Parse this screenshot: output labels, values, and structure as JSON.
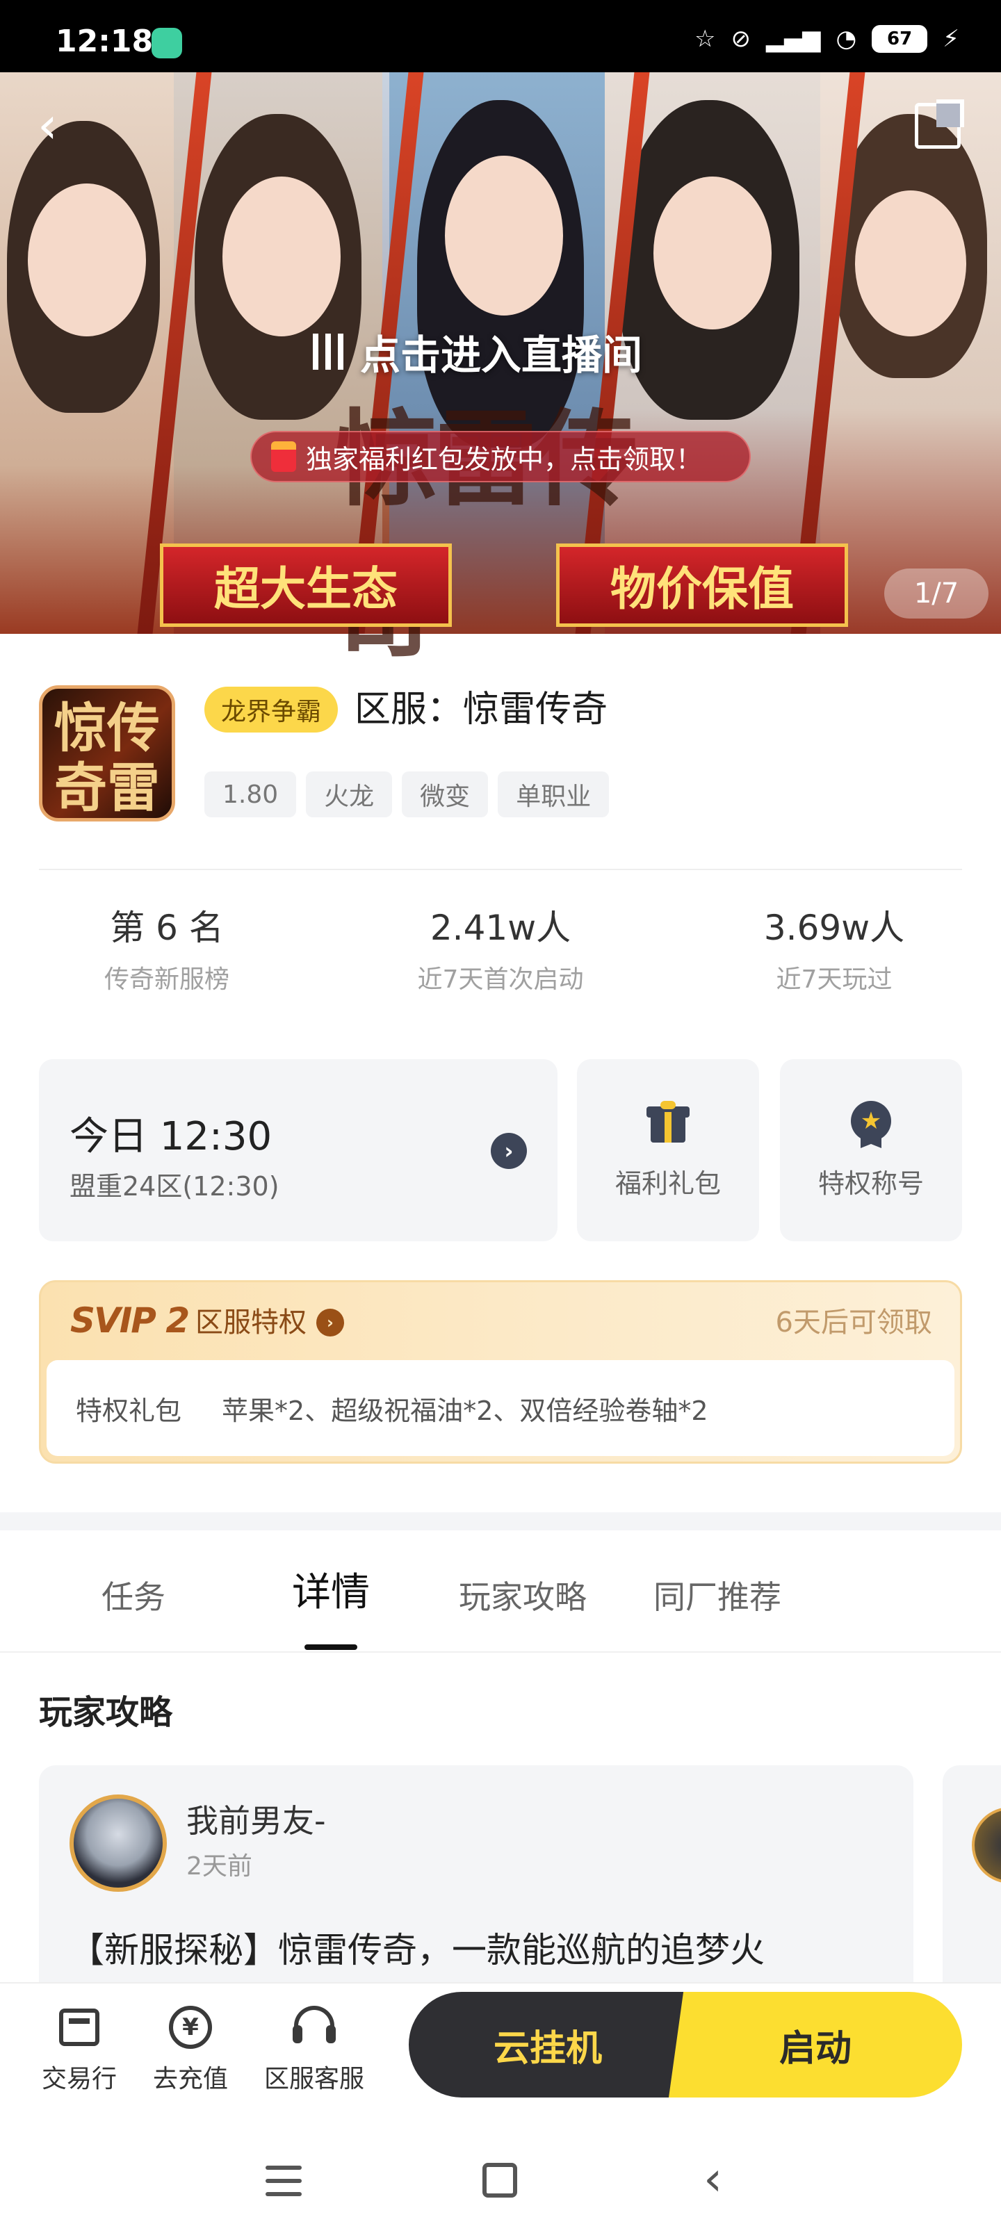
{
  "status_bar": {
    "time": "12:18",
    "battery": "67"
  },
  "banner": {
    "live_cta": "点击进入直播间",
    "red_packet": "独家福利红包发放中，点击领取！",
    "logo_text": "惊雷传奇",
    "slogan_left": "超大生态",
    "slogan_right": "物价保值",
    "page_indicator": "1/7"
  },
  "game": {
    "icon_text": "惊传奇雷",
    "tag": "龙界争霸",
    "title": "区服：惊雷传奇",
    "chips": [
      "1.80",
      "火龙",
      "微变",
      "单职业"
    ]
  },
  "stats": [
    {
      "value": "第 6 名",
      "label": "传奇新服榜"
    },
    {
      "value": "2.41w人",
      "label": "近7天首次启动"
    },
    {
      "value": "3.69w人",
      "label": "近7天玩过"
    }
  ],
  "open_server": {
    "time": "今日 12:30",
    "server": "盟重24区(12:30)"
  },
  "quick_cards": {
    "gift": "福利礼包",
    "title": "特权称号"
  },
  "svip": {
    "logo": "SVIP 2",
    "title": "区服特权",
    "status": "6天后可领取",
    "gift_label": "特权礼包",
    "gift_items": "苹果*2、超级祝福油*2、双倍经验卷轴*2"
  },
  "tabs": [
    "任务",
    "详情",
    "玩家攻略",
    "同厂推荐"
  ],
  "guides": {
    "section_title": "玩家攻略",
    "post": {
      "author": "我前男友-",
      "time": "2天前",
      "text": "【新服探秘】惊雷传奇，一款能巡航的追梦火"
    }
  },
  "bottom_bar": {
    "trade": "交易行",
    "recharge": "去充值",
    "service": "区服客服",
    "cloud": "云挂机",
    "launch": "启动"
  },
  "colors": {
    "accent_yellow": "#fcd74a",
    "dark": "#2f2f33",
    "svip_brown": "#a8561c"
  }
}
